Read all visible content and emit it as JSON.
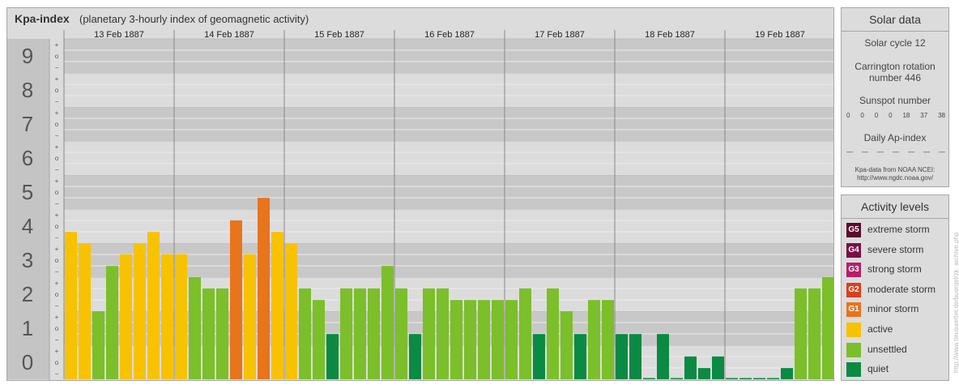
{
  "header": {
    "title": "Kpa-index",
    "subtitle": "(planetary 3-hourly index of geomagnetic activity)"
  },
  "solar": {
    "title": "Solar data",
    "solar_cycle": "Solar cycle 12",
    "carrington_line1": "Carrington rotation",
    "carrington_line2": "number 446",
    "sunspot_label": "Sunspot number",
    "sunspot_values": [
      "0",
      "0",
      "0",
      "0",
      "18",
      "37",
      "38"
    ],
    "ap_label": "Daily Ap-index",
    "ap_values": [
      "—",
      "—",
      "—",
      "—",
      "—",
      "—",
      "—"
    ],
    "source_line1": "Kpa-data from NOAA NCEI:",
    "source_line2": "http://www.ngdc.noaa.gov/"
  },
  "levels": {
    "title": "Activity levels",
    "items": [
      {
        "code": "G5",
        "label": "extreme storm",
        "color": "#5c0a2e"
      },
      {
        "code": "G4",
        "label": "severe storm",
        "color": "#7a0f45"
      },
      {
        "code": "G3",
        "label": "strong storm",
        "color": "#b81d6a"
      },
      {
        "code": "G2",
        "label": "moderate storm",
        "color": "#d8401e"
      },
      {
        "code": "G1",
        "label": "minor storm",
        "color": "#e8741c"
      },
      {
        "code": "",
        "label": "active",
        "color": "#f7c200"
      },
      {
        "code": "",
        "label": "unsettled",
        "color": "#7bbf2a"
      },
      {
        "code": "",
        "label": "quiet",
        "color": "#0a8a42"
      }
    ]
  },
  "watermark": "http://www.tieuswetter.de/buergel/zk_archive.php",
  "chart_data": {
    "type": "bar",
    "y_range": [
      0,
      9
    ],
    "y_ticks": [
      "0",
      "1",
      "2",
      "3",
      "4",
      "5",
      "6",
      "7",
      "8",
      "9"
    ],
    "sub_ticks": [
      "−",
      "o",
      "+"
    ],
    "days": [
      "13 Feb 1887",
      "14 Feb 1887",
      "15 Feb 1887",
      "16 Feb 1887",
      "17 Feb 1887",
      "18 Feb 1887",
      "19 Feb 1887"
    ],
    "slot_start": [
      "0",
      "3",
      "6",
      "9",
      "12",
      "15",
      "18",
      "21"
    ],
    "slot_end": [
      "3",
      "6",
      "9",
      "12",
      "15",
      "18",
      "21",
      "24"
    ],
    "colors": {
      "quiet": "#0a8a42",
      "unsettled": "#7bbf2a",
      "active": "#f7c200",
      "minor": "#e8741c"
    },
    "values": [
      4.33,
      4.0,
      2.0,
      3.33,
      3.67,
      4.0,
      4.33,
      3.67,
      3.67,
      3.0,
      2.67,
      2.67,
      4.67,
      3.67,
      5.33,
      4.33,
      4.0,
      2.67,
      2.33,
      1.33,
      2.67,
      2.67,
      2.67,
      3.33,
      2.67,
      1.33,
      2.67,
      2.67,
      2.33,
      2.33,
      2.33,
      2.33,
      2.33,
      2.67,
      1.33,
      2.67,
      2.0,
      1.33,
      2.33,
      2.33,
      1.33,
      1.33,
      0.0,
      1.33,
      0.0,
      0.67,
      0.33,
      0.67,
      0.0,
      0.0,
      0.0,
      0.0,
      0.33,
      2.67,
      2.67,
      3.0
    ]
  }
}
